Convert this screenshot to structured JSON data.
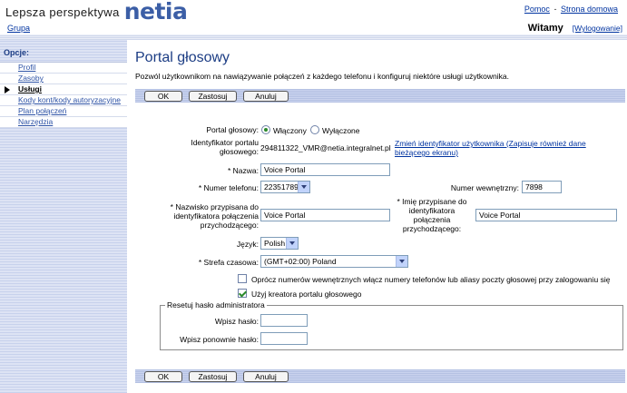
{
  "header": {
    "brand_tagline": "Lepsza perspektywa",
    "brand_logo": "netia",
    "group_link": "Grupa",
    "help_link": "Pomoc",
    "separator": "-",
    "home_link": "Strona domowa",
    "welcome": "Witamy",
    "logout": "[Wylogowanie]"
  },
  "sidebar": {
    "title": "Opcje:",
    "items": [
      {
        "label": "Profil",
        "current": false
      },
      {
        "label": "Zasoby",
        "current": false
      },
      {
        "label": "Usługi",
        "current": true
      },
      {
        "label": "Kody kont/kody autoryzacyjne",
        "current": false
      },
      {
        "label": "Plan połączeń",
        "current": false
      },
      {
        "label": "Narzędzia",
        "current": false
      }
    ]
  },
  "page": {
    "title": "Portal głosowy",
    "description": "Pozwól użytkownikom na nawiązywanie połączeń z każdego telefonu i konfiguruj niektóre usługi użytkownika."
  },
  "buttons": {
    "ok": "OK",
    "apply": "Zastosuj",
    "cancel": "Anuluj"
  },
  "form": {
    "portal_label": "Portal głosowy:",
    "portal_on": "Włączony",
    "portal_off": "Wyłączone",
    "portal_enabled": true,
    "id_label_1": "Identyfikator portalu",
    "id_label_2": "głosowego:",
    "id_value": "294811322_VMR@netia.integralnet.pl",
    "change_id_link_1": "Zmień identyfikator użytkownika (Zapisuje również dane",
    "change_id_link_2": "bieżącego ekranu)",
    "name_label": "* Nazwa:",
    "name_value": "Voice Portal",
    "phone_label": "* Numer telefonu:",
    "phone_value": "223517898",
    "ext_label": "Numer wewnętrzny:",
    "ext_value": "7898",
    "lastname_label_1": "* Nazwisko przypisana do",
    "lastname_label_2": "identyfikatora połączenia",
    "lastname_label_3": "przychodzącego:",
    "lastname_value": "Voice Portal",
    "firstname_label_1": "* Imię przypisane do",
    "firstname_label_2": "identyfikatora",
    "firstname_label_3": "połączenia",
    "firstname_label_4": "przychodzącego:",
    "firstname_value": "Voice Portal",
    "lang_label": "Język:",
    "lang_value": "Polish",
    "tz_label": "* Strefa czasowa:",
    "tz_value": "(GMT+02:00) Poland",
    "chk_aliases_label": "Oprócz numerów wewnętrznych włącz numery telefonów lub aliasy poczty głosowej przy zalogowaniu się",
    "chk_aliases_checked": false,
    "chk_wizard_label": "Użyj kreatora portalu głosowego",
    "chk_wizard_checked": true,
    "reset_legend": "Resetuj hasło administratora",
    "pw_label": "Wpisz hasło:",
    "pw_confirm_label": "Wpisz ponownie hasło:",
    "pw_value": "",
    "pw_confirm_value": ""
  },
  "colors": {
    "brand_blue": "#3b5ea6",
    "title_blue": "#1c3d84",
    "link_blue": "#0033a0"
  }
}
